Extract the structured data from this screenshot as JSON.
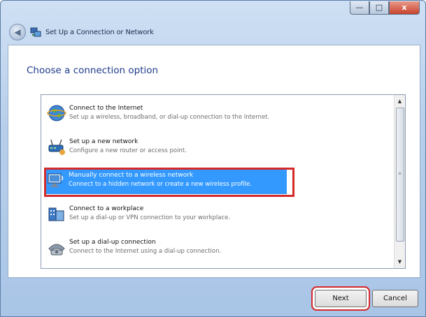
{
  "window": {
    "title": "Set Up a Connection or Network",
    "controls": {
      "minimize": "—",
      "maximize": "□",
      "close": "x"
    }
  },
  "main": {
    "heading": "Choose a connection option",
    "options": [
      {
        "title": "Connect to the Internet",
        "description": "Set up a wireless, broadband, or dial-up connection to the Internet.",
        "icon": "globe-icon"
      },
      {
        "title": "Set up a new network",
        "description": "Configure a new router or access point.",
        "icon": "router-icon"
      },
      {
        "title": "Manually connect to a wireless network",
        "description": "Connect to a hidden network or create a new wireless profile.",
        "icon": "wireless-computer-icon",
        "selected": true
      },
      {
        "title": "Connect to a workplace",
        "description": "Set up a dial-up or VPN connection to your workplace.",
        "icon": "workplace-icon"
      },
      {
        "title": "Set up a dial-up connection",
        "description": "Connect to the Internet using a dial-up connection.",
        "icon": "phone-icon"
      }
    ]
  },
  "footer": {
    "next_label": "Next",
    "cancel_label": "Cancel"
  },
  "colors": {
    "selection": "#3399ff",
    "highlight_box": "#d42a2a",
    "heading": "#1e3b8a"
  }
}
